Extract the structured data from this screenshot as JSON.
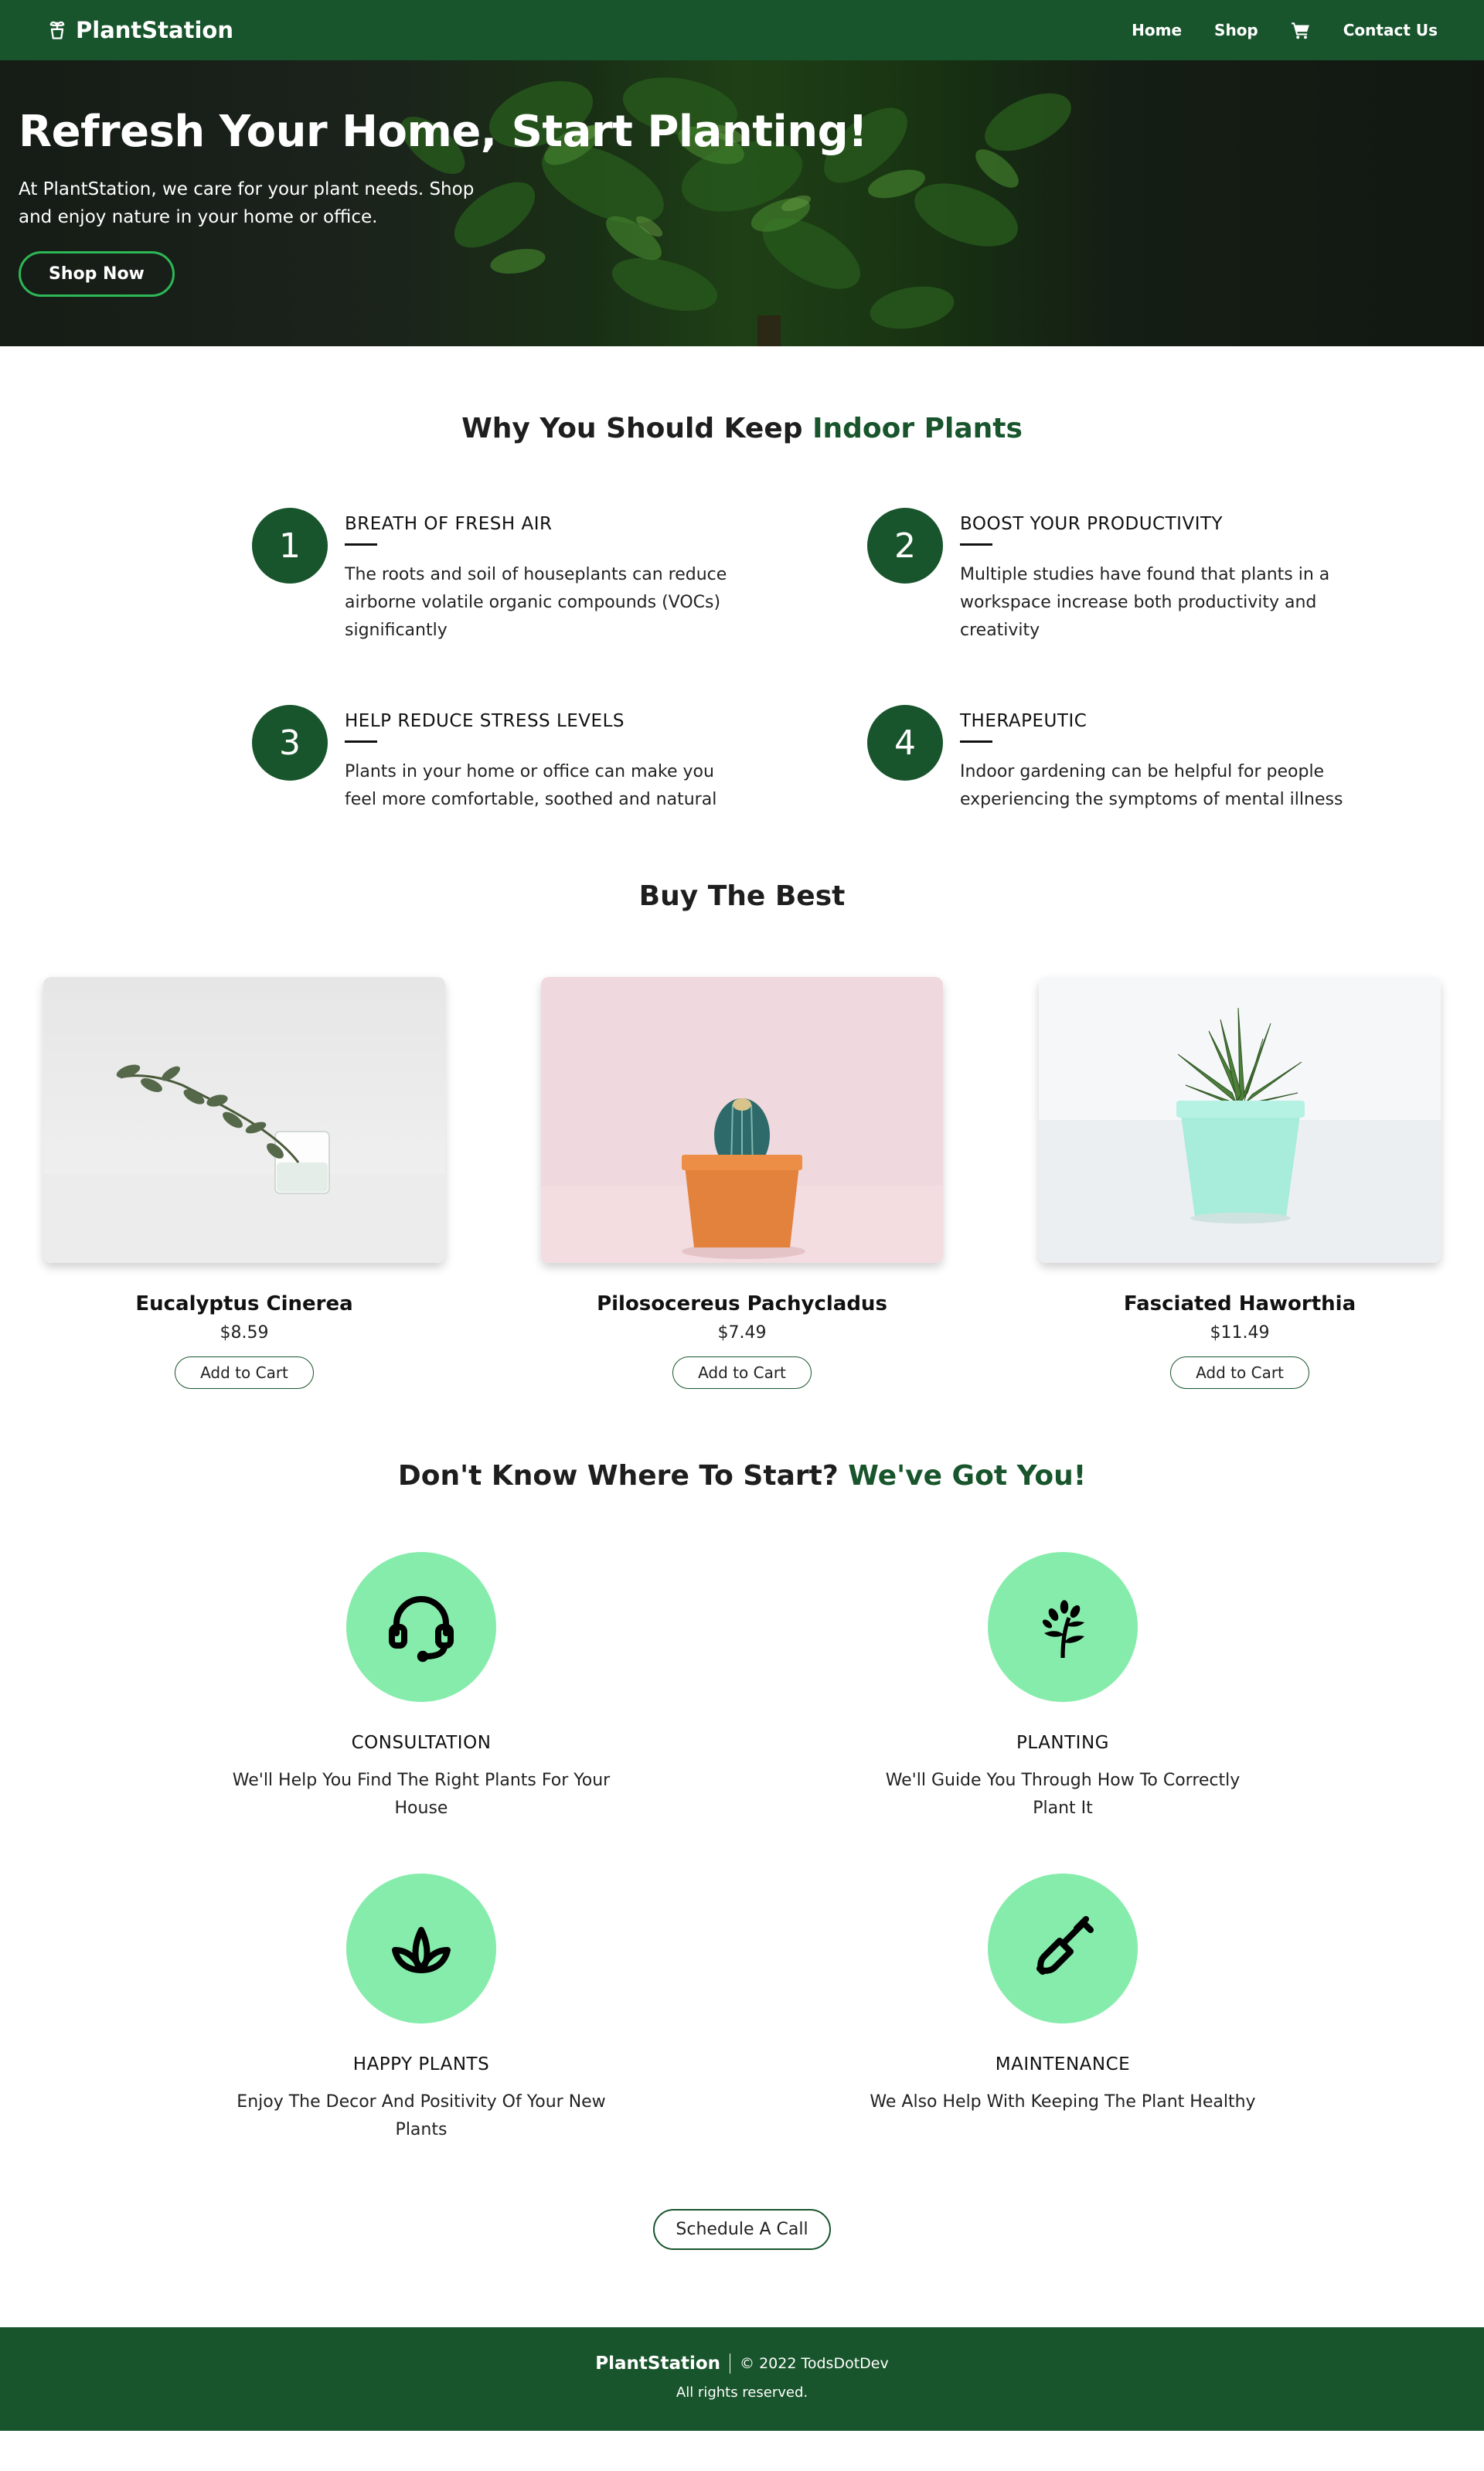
{
  "nav": {
    "brand": "PlantStation",
    "links": [
      "Home",
      "Shop",
      "Contact Us"
    ]
  },
  "hero": {
    "title": "Refresh Your Home, Start Planting!",
    "subtitle": "At PlantStation, we care for your plant needs. Shop and enjoy nature in your home or office.",
    "cta": "Shop Now"
  },
  "why": {
    "title_prefix": "Why You Should Keep",
    "title_accent": "Indoor Plants",
    "items": [
      {
        "num": "1",
        "title": "BREATH OF FRESH AIR",
        "text": "The roots and soil of houseplants can reduce airborne volatile organic compounds (VOCs) significantly"
      },
      {
        "num": "2",
        "title": "BOOST YOUR PRODUCTIVITY",
        "text": "Multiple studies have found that plants in a workspace increase both productivity and creativity"
      },
      {
        "num": "3",
        "title": "HELP REDUCE STRESS LEVELS",
        "text": "Plants in your home or office can make you feel more comfortable, soothed and natural"
      },
      {
        "num": "4",
        "title": "THERAPEUTIC",
        "text": "Indoor gardening can be helpful for people experiencing the symptoms of mental illness"
      }
    ]
  },
  "buy": {
    "title": "Buy The Best",
    "products": [
      {
        "name": "Eucalyptus Cinerea",
        "price": "$8.59",
        "cta": "Add to Cart"
      },
      {
        "name": "Pilosocereus Pachycladus",
        "price": "$7.49",
        "cta": "Add to Cart"
      },
      {
        "name": "Fasciated Haworthia",
        "price": "$11.49",
        "cta": "Add to Cart"
      }
    ]
  },
  "services": {
    "title_prefix": "Don't Know Where To Start?",
    "title_accent": "We've Got You!",
    "items": [
      {
        "icon": "headset-icon",
        "title": "CONSULTATION",
        "text": "We'll Help You Find The Right Plants For Your House"
      },
      {
        "icon": "sprout-icon",
        "title": "PLANTING",
        "text": "We'll Guide You Through How To Correctly Plant It"
      },
      {
        "icon": "lotus-icon",
        "title": "HAPPY PLANTS",
        "text": "Enjoy The Decor And Positivity Of Your New Plants"
      },
      {
        "icon": "shovel-icon",
        "title": "MAINTENANCE",
        "text": "We Also Help With Keeping The Plant Healthy"
      }
    ],
    "cta": "Schedule A Call"
  },
  "footer": {
    "brand": "PlantStation",
    "copyright": "© 2022 TodsDotDev",
    "rights": "All rights reserved."
  },
  "colors": {
    "brand_green": "#18552c",
    "service_circle": "#86ecab",
    "hero_button_border": "#2db757"
  }
}
